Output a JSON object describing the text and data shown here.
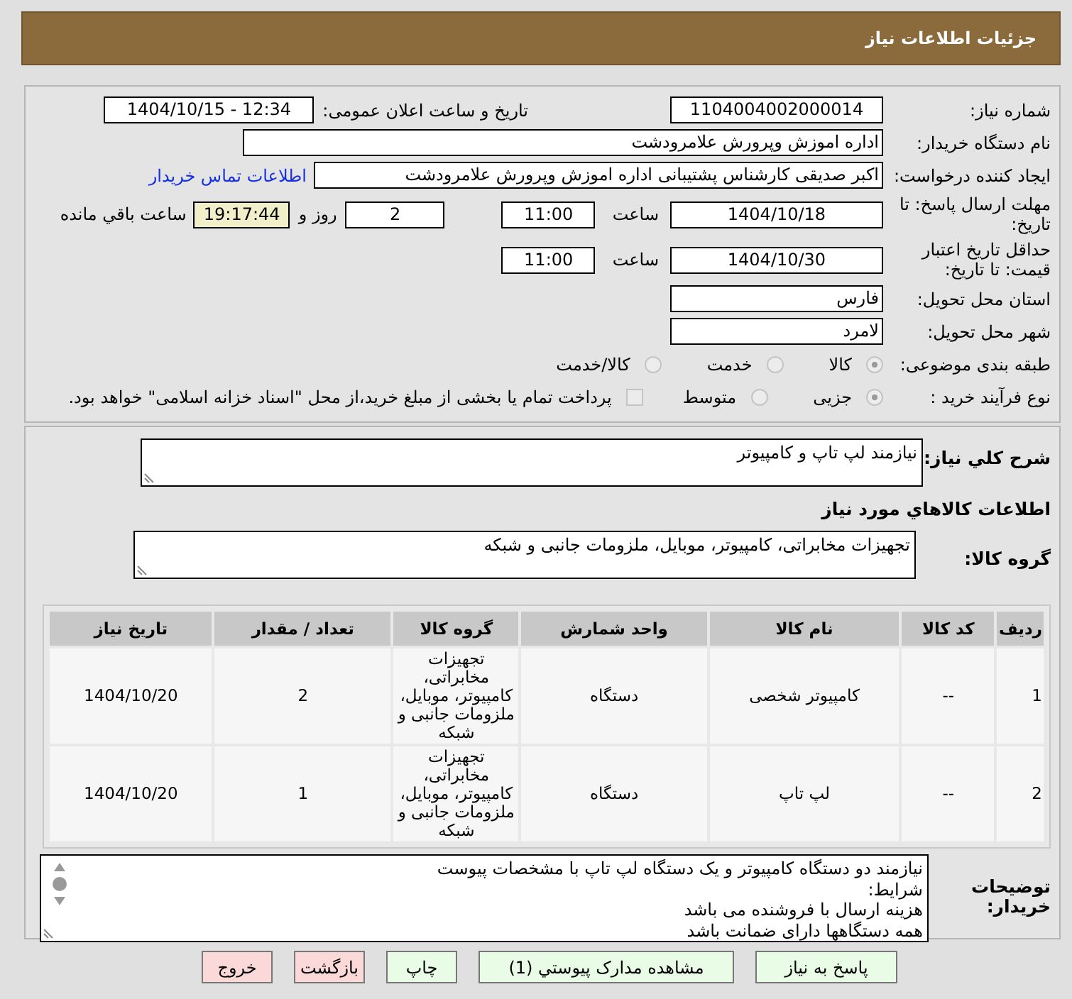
{
  "header": {
    "title": "جزئیات اطلاعات نیاز"
  },
  "need_number": {
    "label": "شماره نیاز:",
    "value": "1104004002000014"
  },
  "announce": {
    "label": "تاریخ و ساعت اعلان عمومی:",
    "value": "1404/10/15 - 12:34"
  },
  "buyer_org": {
    "label": "نام دستگاه خریدار:",
    "value": "اداره اموزش وپرورش علامرودشت"
  },
  "creator": {
    "label": "ایجاد کننده درخواست:",
    "value": "اکبر صدیقی کارشناس پشتیبانی اداره اموزش وپرورش علامرودشت",
    "link": "اطلاعات تماس خریدار"
  },
  "deadline": {
    "label": "مهلت ارسال پاسخ: تا تاریخ:",
    "date": "1404/10/18",
    "time_label": "ساعت",
    "time": "11:00",
    "days": "2",
    "days_label": "روز و",
    "remaining": "19:17:44",
    "remaining_label": "ساعت باقي مانده"
  },
  "validity": {
    "label": "حداقل تاریخ اعتبار قیمت: تا تاریخ:",
    "date": "1404/10/30",
    "time_label": "ساعت",
    "time": "11:00"
  },
  "province": {
    "label": "استان محل تحویل:",
    "value": "فارس"
  },
  "city": {
    "label": "شهر محل تحویل:",
    "value": "لامرد"
  },
  "category": {
    "label": "طبقه بندی موضوعی:",
    "options": [
      {
        "label": "کالا",
        "selected": true
      },
      {
        "label": "خدمت",
        "selected": false
      },
      {
        "label": "کالا/خدمت",
        "selected": false
      }
    ]
  },
  "process": {
    "label": "نوع فرآیند خرید :",
    "options": [
      {
        "label": "جزیی",
        "selected": true
      },
      {
        "label": "متوسط",
        "selected": false
      }
    ],
    "payment_option": {
      "label": "پرداخت تمام یا بخشی از مبلغ خرید،از محل \"اسناد خزانه اسلامی\" خواهد بود.",
      "checked": false
    }
  },
  "summary": {
    "label": "شرح کلي نیاز:",
    "value": "نیازمند لپ تاپ و کامپیوتر"
  },
  "goods_heading": "اطلاعات کالاهاي مورد نیاز",
  "goods_group": {
    "label": "گروه کالا:",
    "value": "تجهیزات مخابراتی، کامپیوتر، موبایل، ملزومات جانبی و شبکه"
  },
  "table": {
    "columns": [
      "ردیف",
      "کد کالا",
      "نام کالا",
      "واحد شمارش",
      "گروه کالا",
      "تعداد / مقدار",
      "تاریخ نیاز"
    ],
    "rows": [
      [
        "1",
        "--",
        "کامپیوتر شخصی",
        "دستگاه",
        "تجهیزات مخابراتی، کامپیوتر، موبایل، ملزومات جانبی و شبکه",
        "2",
        "1404/10/20"
      ],
      [
        "2",
        "--",
        "لپ تاپ",
        "دستگاه",
        "تجهیزات مخابراتی، کامپیوتر، موبایل، ملزومات جانبی و شبکه",
        "1",
        "1404/10/20"
      ]
    ]
  },
  "buyer_notes": {
    "label": "توضیحات خریدار:",
    "lines": [
      "نیازمند  دو  دستگاه  کامپیوتر  و یک دستگاه لپ تاپ با مشخصات پیوست",
      "شرایط:",
      "هزینه ارسال با فروشنده می باشد",
      "همه دستگاهها دارای ضمانت باشد"
    ]
  },
  "buttons": [
    {
      "label": "پاسخ به نیاز",
      "kind": "action"
    },
    {
      "label": "مشاهده مدارک پیوستي (1)",
      "kind": "action"
    },
    {
      "label": "چاپ",
      "kind": "action"
    },
    {
      "label": "بازگشت",
      "kind": "exit"
    },
    {
      "label": "خروج",
      "kind": "exit"
    }
  ]
}
